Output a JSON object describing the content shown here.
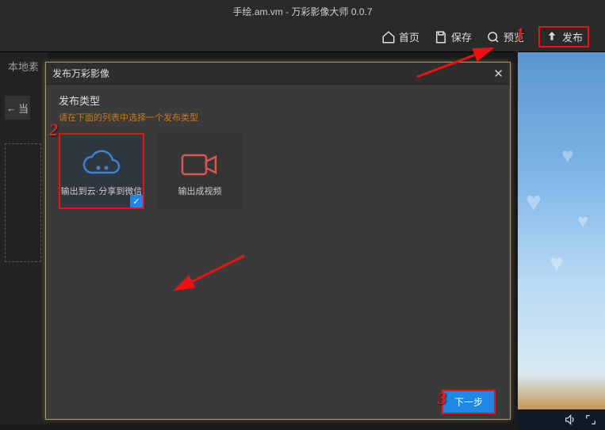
{
  "titlebar": {
    "text": "手绘.am.vm - 万彩影像大师 0.0.7"
  },
  "toolbar": {
    "home": "首页",
    "save": "保存",
    "preview": "预览",
    "publish": "发布"
  },
  "sidebar": {
    "local": "本地素",
    "back": "当"
  },
  "modal": {
    "title": "发布万彩影像",
    "section_title": "发布类型",
    "section_hint": "请在下面的列表中选择一个发布类型",
    "options": [
      {
        "label": "输出到云·分享到微信"
      },
      {
        "label": "输出成视频"
      }
    ],
    "next": "下一步"
  },
  "annotations": {
    "n1": "1",
    "n2": "2",
    "n3": "3"
  }
}
